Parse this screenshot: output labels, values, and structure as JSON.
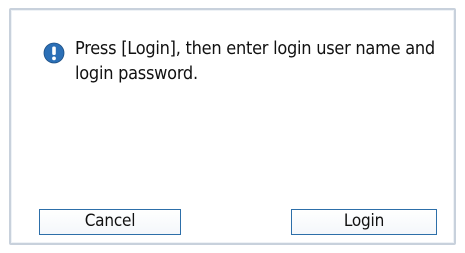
{
  "dialog": {
    "icon": "alert-icon",
    "message": "Press [Login], then enter login user name and login password."
  },
  "buttons": {
    "cancel_label": "Cancel",
    "login_label": "Login"
  },
  "colors": {
    "icon_fill": "#2b6fb6",
    "button_border": "#2d6fa9",
    "panel_border": "#c8d1dc"
  }
}
